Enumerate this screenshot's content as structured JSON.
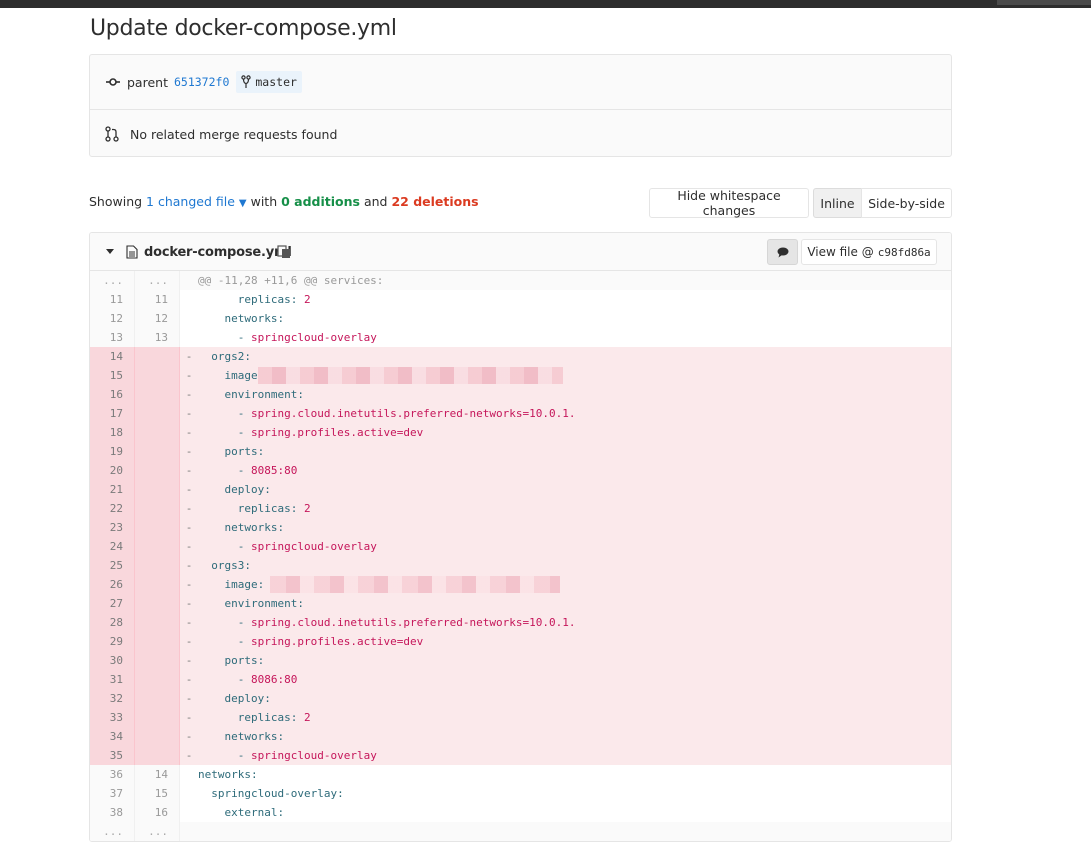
{
  "page": {
    "title": "Update docker-compose.yml"
  },
  "commit": {
    "parent_label": "parent",
    "parent_sha": "651372f0",
    "branch": "master",
    "merge_requests_text": "No related merge requests found"
  },
  "stats": {
    "showing": "Showing",
    "changed_files": "1 changed file",
    "with": "with",
    "additions": "0 additions",
    "and": "and",
    "deletions": "22 deletions"
  },
  "toolbar": {
    "hide_whitespace_label": "Hide whitespace changes",
    "inline_label": "Inline",
    "side_by_side_label": "Side-by-side"
  },
  "file": {
    "name": "docker-compose.yml",
    "view_file_label": "View file @",
    "view_file_sha": "c98fd86a"
  },
  "diff": {
    "hunk_header": "@@ -11,28 +11,6 @@ services:",
    "lines": [
      {
        "type": "match",
        "old": "...",
        "new": "...",
        "code": ""
      },
      {
        "type": "ctx",
        "old": "11",
        "new": "11",
        "indent": "      ",
        "key": "replicas:",
        "val": " 2"
      },
      {
        "type": "ctx",
        "old": "12",
        "new": "12",
        "indent": "    ",
        "key": "networks:",
        "val": ""
      },
      {
        "type": "ctx",
        "old": "13",
        "new": "13",
        "indent": "      ",
        "key": "- ",
        "val": "springcloud-overlay"
      },
      {
        "type": "del",
        "old": "14",
        "new": "",
        "indent": "  ",
        "key": "orgs2:",
        "val": ""
      },
      {
        "type": "del",
        "old": "15",
        "new": "",
        "indent": "    ",
        "key": "image",
        "val": ""
      },
      {
        "type": "del",
        "old": "16",
        "new": "",
        "indent": "    ",
        "key": "environment:",
        "val": ""
      },
      {
        "type": "del",
        "old": "17",
        "new": "",
        "indent": "      ",
        "key": "- ",
        "val": "spring.cloud.inetutils.preferred-networks=10.0.1."
      },
      {
        "type": "del",
        "old": "18",
        "new": "",
        "indent": "      ",
        "key": "- ",
        "val": "spring.profiles.active=dev"
      },
      {
        "type": "del",
        "old": "19",
        "new": "",
        "indent": "    ",
        "key": "ports:",
        "val": ""
      },
      {
        "type": "del",
        "old": "20",
        "new": "",
        "indent": "      ",
        "key": "- ",
        "val": "8085:80"
      },
      {
        "type": "del",
        "old": "21",
        "new": "",
        "indent": "    ",
        "key": "deploy:",
        "val": ""
      },
      {
        "type": "del",
        "old": "22",
        "new": "",
        "indent": "      ",
        "key": "replicas:",
        "val": " 2"
      },
      {
        "type": "del",
        "old": "23",
        "new": "",
        "indent": "    ",
        "key": "networks:",
        "val": ""
      },
      {
        "type": "del",
        "old": "24",
        "new": "",
        "indent": "      ",
        "key": "- ",
        "val": "springcloud-overlay"
      },
      {
        "type": "del",
        "old": "25",
        "new": "",
        "indent": "  ",
        "key": "orgs3:",
        "val": ""
      },
      {
        "type": "del",
        "old": "26",
        "new": "",
        "indent": "    ",
        "key": "image:",
        "val": ""
      },
      {
        "type": "del",
        "old": "27",
        "new": "",
        "indent": "    ",
        "key": "environment:",
        "val": ""
      },
      {
        "type": "del",
        "old": "28",
        "new": "",
        "indent": "      ",
        "key": "- ",
        "val": "spring.cloud.inetutils.preferred-networks=10.0.1."
      },
      {
        "type": "del",
        "old": "29",
        "new": "",
        "indent": "      ",
        "key": "- ",
        "val": "spring.profiles.active=dev"
      },
      {
        "type": "del",
        "old": "30",
        "new": "",
        "indent": "    ",
        "key": "ports:",
        "val": ""
      },
      {
        "type": "del",
        "old": "31",
        "new": "",
        "indent": "      ",
        "key": "- ",
        "val": "8086:80"
      },
      {
        "type": "del",
        "old": "32",
        "new": "",
        "indent": "    ",
        "key": "deploy:",
        "val": ""
      },
      {
        "type": "del",
        "old": "33",
        "new": "",
        "indent": "      ",
        "key": "replicas:",
        "val": " 2"
      },
      {
        "type": "del",
        "old": "34",
        "new": "",
        "indent": "    ",
        "key": "networks:",
        "val": ""
      },
      {
        "type": "del",
        "old": "35",
        "new": "",
        "indent": "      ",
        "key": "- ",
        "val": "springcloud-overlay"
      },
      {
        "type": "ctx",
        "old": "36",
        "new": "14",
        "indent": "",
        "key": "networks:",
        "val": ""
      },
      {
        "type": "ctx",
        "old": "37",
        "new": "15",
        "indent": "  ",
        "key": "springcloud-overlay:",
        "val": ""
      },
      {
        "type": "ctx",
        "old": "38",
        "new": "16",
        "indent": "    ",
        "key": "external:",
        "val": ""
      },
      {
        "type": "match",
        "old": "...",
        "new": "...",
        "code": ""
      }
    ]
  }
}
